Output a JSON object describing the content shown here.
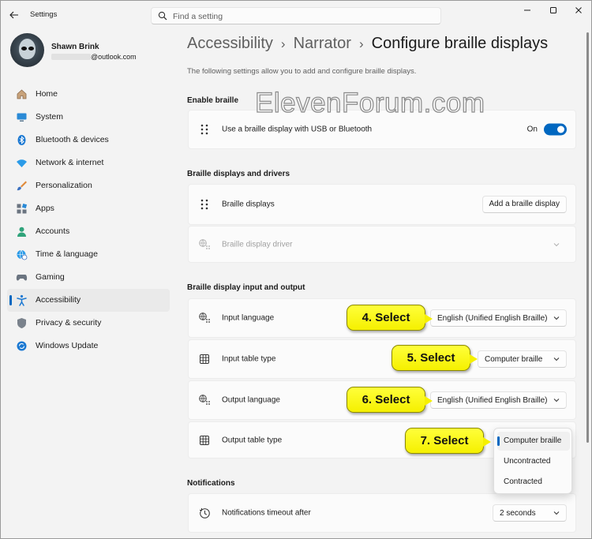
{
  "window": {
    "app_title": "Settings",
    "minimize_icon": "minimize-icon",
    "maximize_icon": "maximize-icon",
    "close_icon": "close-icon"
  },
  "search": {
    "placeholder": "Find a setting"
  },
  "profile": {
    "name": "Shawn Brink",
    "email_suffix": "@outlook.com"
  },
  "nav": {
    "items": [
      {
        "label": "Home",
        "icon": "home-icon"
      },
      {
        "label": "System",
        "icon": "system-icon"
      },
      {
        "label": "Bluetooth & devices",
        "icon": "bluetooth-icon"
      },
      {
        "label": "Network & internet",
        "icon": "wifi-icon"
      },
      {
        "label": "Personalization",
        "icon": "brush-icon"
      },
      {
        "label": "Apps",
        "icon": "apps-icon"
      },
      {
        "label": "Accounts",
        "icon": "accounts-icon"
      },
      {
        "label": "Time & language",
        "icon": "globe-clock-icon"
      },
      {
        "label": "Gaming",
        "icon": "gamepad-icon"
      },
      {
        "label": "Accessibility",
        "icon": "accessibility-icon",
        "active": true
      },
      {
        "label": "Privacy & security",
        "icon": "shield-icon"
      },
      {
        "label": "Windows Update",
        "icon": "update-icon"
      }
    ]
  },
  "breadcrumb": [
    "Accessibility",
    "Narrator",
    "Configure braille displays"
  ],
  "intro": "The following settings allow you to add and configure braille displays.",
  "sections": {
    "enable": {
      "title": "Enable braille",
      "row_label": "Use a braille display with USB or Bluetooth",
      "toggle_state": "On"
    },
    "drivers": {
      "title": "Braille displays and drivers",
      "displays_label": "Braille displays",
      "add_button": "Add a braille display",
      "driver_label": "Braille display driver"
    },
    "io": {
      "title": "Braille display input and output",
      "input_language_label": "Input language",
      "input_language_value": "English (Unified English Braille)",
      "input_table_label": "Input table type",
      "input_table_value": "Computer braille",
      "output_language_label": "Output language",
      "output_language_value": "English (Unified English Braille)",
      "output_table_label": "Output table type"
    },
    "notifications": {
      "title": "Notifications",
      "timeout_label": "Notifications timeout after",
      "timeout_value": "2 seconds"
    }
  },
  "output_table_menu": {
    "options": [
      "Computer braille",
      "Uncontracted",
      "Contracted"
    ],
    "selected": "Computer braille"
  },
  "callouts": [
    "4. Select",
    "5. Select",
    "6. Select",
    "7. Select"
  ],
  "watermark": "ElevenForum.com",
  "colors": {
    "accent": "#0067c0",
    "callout": "#f5f000",
    "background": "#f3f3f3",
    "card": "#fbfbfb"
  }
}
